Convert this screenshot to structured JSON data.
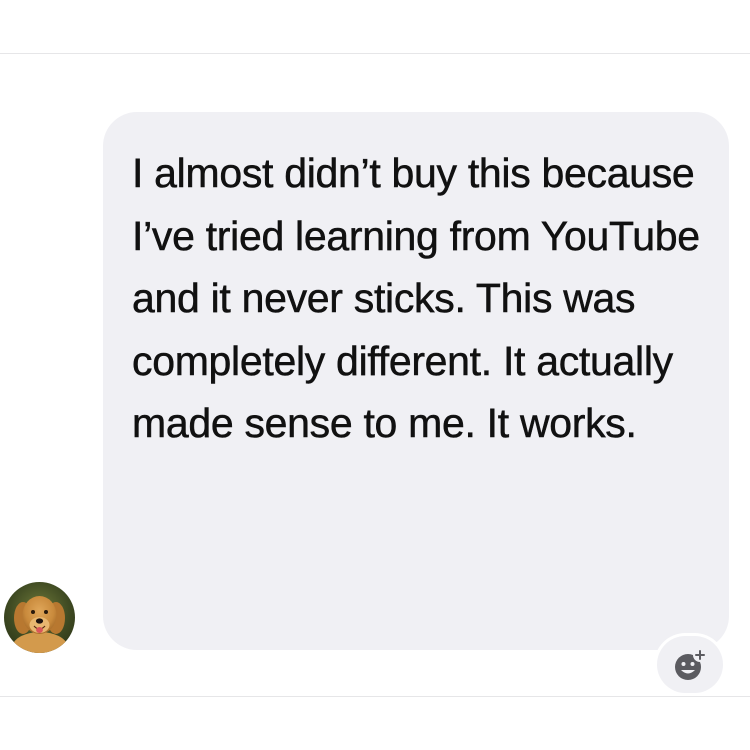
{
  "conversation": {
    "message": {
      "text": "I almost didn’t buy this because I’ve tried learning from YouTube and it never sticks. This was completely different. It actually made sense to me. It works."
    },
    "sender": {
      "avatar_icon": "golden-retriever-avatar"
    },
    "reaction": {
      "icon": "add-reaction-icon"
    }
  },
  "colors": {
    "bubble": "#f0f0f4",
    "text": "#111111",
    "background": "#ffffff",
    "divider": "#e6e6e8"
  }
}
